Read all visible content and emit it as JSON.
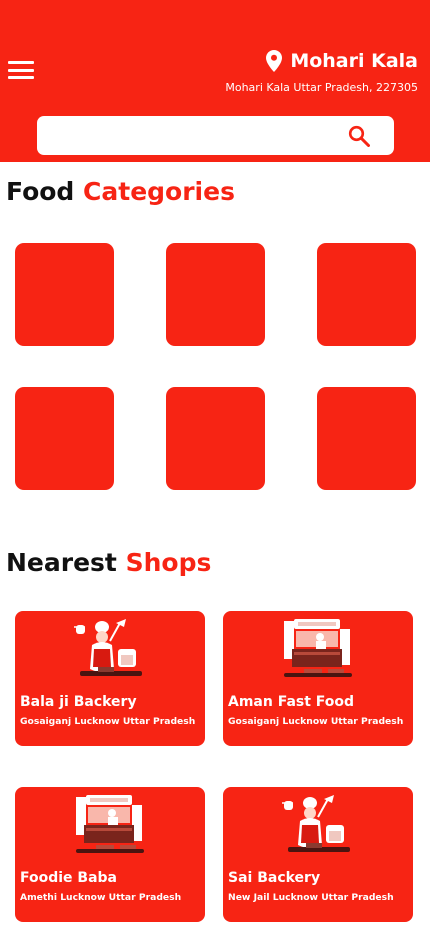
{
  "header": {
    "menu_icon": "hamburger-menu-icon",
    "location_icon": "map-pin-icon",
    "location_title": "Mohari Kala",
    "location_subtitle": "Mohari Kala Uttar Pradesh, 227305",
    "background_color": "#f72414"
  },
  "search": {
    "placeholder": "",
    "value": "",
    "icon": "search-icon"
  },
  "categories": {
    "title_plain": "Food",
    "title_accent": "Categories",
    "tiles": [
      "",
      "",
      "",
      "",
      "",
      ""
    ]
  },
  "shops": {
    "title_plain": "Nearest",
    "title_accent": "Shops",
    "items": [
      {
        "name": "Bala ji Backery",
        "address": "Gosaiganj Lucknow Uttar Pradesh",
        "illustration": "chef-bakery-illustration"
      },
      {
        "name": "Aman Fast Food",
        "address": "Gosaiganj Lucknow Uttar Pradesh",
        "illustration": "food-stall-illustration"
      },
      {
        "name": "Foodie Baba",
        "address": "Amethi Lucknow Uttar Pradesh",
        "illustration": "food-stall-illustration"
      },
      {
        "name": "Sai Backery",
        "address": "New Jail Lucknow Uttar Pradesh",
        "illustration": "chef-bakery-illustration"
      }
    ]
  },
  "colors": {
    "accent": "#f72414",
    "text": "#111111",
    "surface": "#ffffff"
  }
}
